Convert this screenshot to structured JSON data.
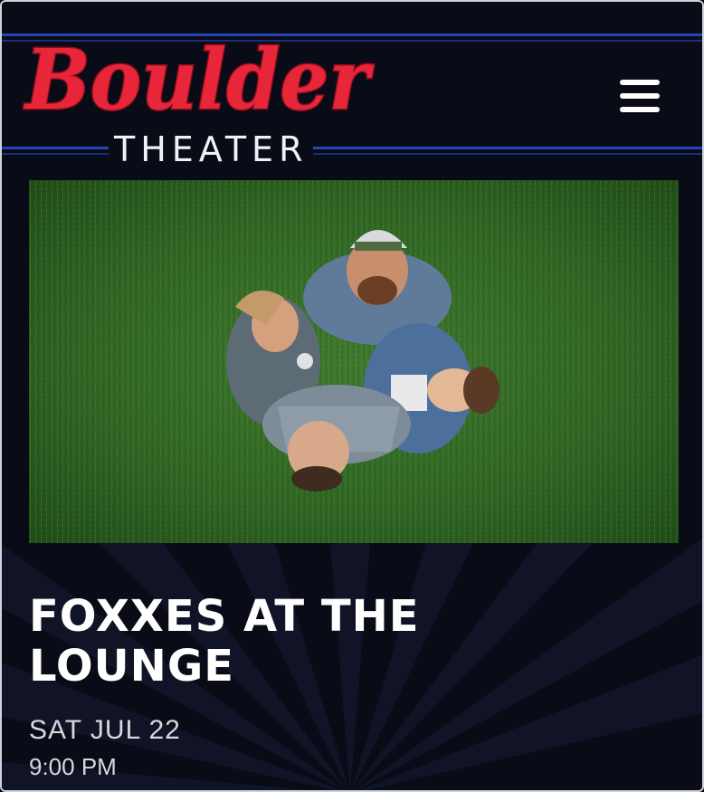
{
  "header": {
    "logo": {
      "script_text": "Boulder",
      "sub_text": "THEATER"
    },
    "menu_icon": "hamburger-menu-icon"
  },
  "hero": {
    "alt": "Four band members standing in a circle on grass, looking up at the camera"
  },
  "event": {
    "title_line1": "FOXXES AT THE",
    "title_line2": "LOUNGE",
    "date": "SAT JUL 22",
    "time": "9:00 PM"
  },
  "colors": {
    "background": "#090b16",
    "logo_red": "#e8263a",
    "stripe_blue": "#2346b8",
    "text_white": "#ffffff",
    "text_muted": "#d6d8de"
  }
}
